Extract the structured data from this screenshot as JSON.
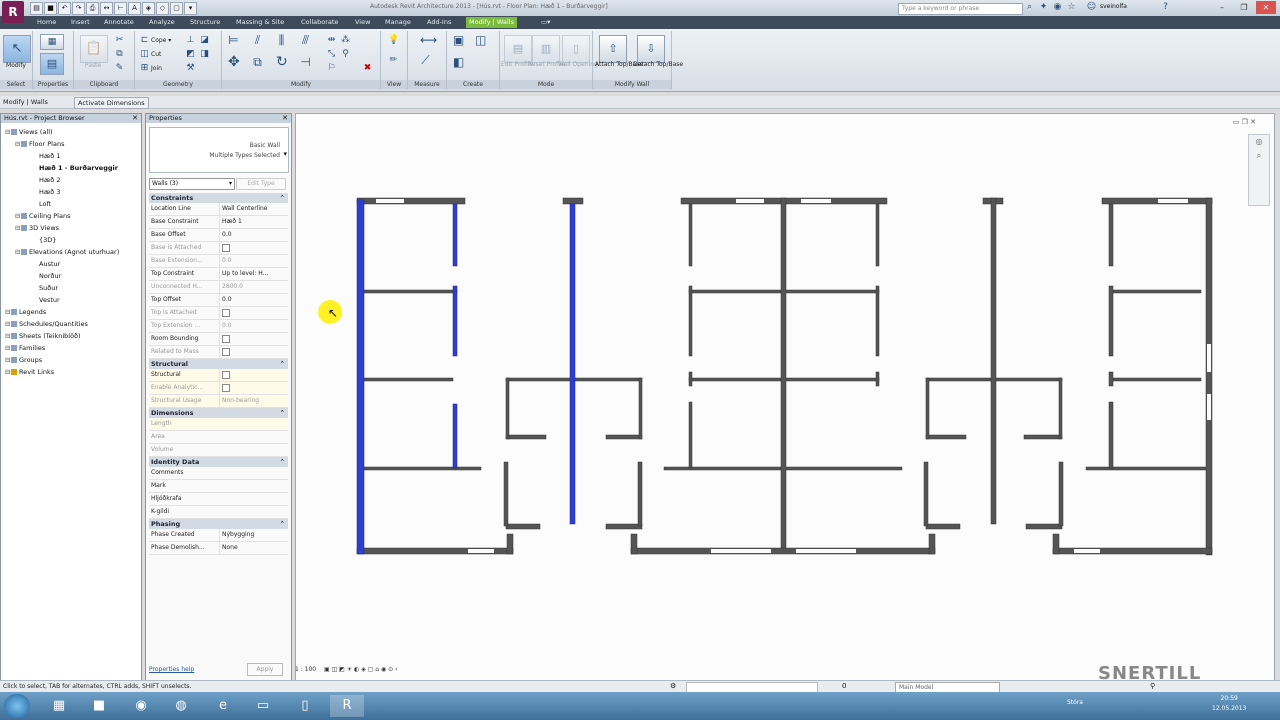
{
  "app": {
    "icon_letter": "R",
    "title": "Autodesk Revit Architecture 2013 - [Hús.rvt - Floor Plan: Hæð 1 - Burðarveggir]",
    "search_placeholder": "Type a keyword or phrase",
    "user": "sveinolfa"
  },
  "tabs": [
    "Home",
    "Insert",
    "Annotate",
    "Analyze",
    "Structure",
    "Massing & Site",
    "Collaborate",
    "View",
    "Manage",
    "Add-Ins",
    "Modify | Walls"
  ],
  "ribbon": {
    "select": {
      "modify_label": "Modify",
      "panel": "Select"
    },
    "properties": {
      "panel": "Properties"
    },
    "clipboard": {
      "paste_label": "Paste",
      "copy_label": "Copy",
      "cut_label": "Cut",
      "join_label": "Join",
      "panel": "Clipboard"
    },
    "geometry": {
      "panel": "Geometry"
    },
    "modify": {
      "panel": "Modify"
    },
    "view": {
      "panel": "View"
    },
    "measure": {
      "panel": "Measure"
    },
    "create": {
      "panel": "Create"
    },
    "mode": {
      "edit_profile": "Edit Profile",
      "reset_profile": "Reset Profile",
      "wall_opening": "Wall Opening",
      "panel": "Mode"
    },
    "modify_wall": {
      "attach": "Attach Top/Base",
      "detach": "Detach Top/Base",
      "panel": "Modify Wall"
    }
  },
  "options_bar": {
    "context": "Modify | Walls",
    "activate_dimensions": "Activate Dimensions"
  },
  "project_browser": {
    "title": "Hús.rvt - Project Browser",
    "items": [
      {
        "label": "Views (all)",
        "level": 0,
        "bold": false
      },
      {
        "label": "Floor Plans",
        "level": 1,
        "bold": false
      },
      {
        "label": "Hæð 1",
        "level": 2,
        "bold": false
      },
      {
        "label": "Hæð 1 - Burðarveggir",
        "level": 2,
        "bold": true
      },
      {
        "label": "Hæð 2",
        "level": 2,
        "bold": false
      },
      {
        "label": "Hæð 3",
        "level": 2,
        "bold": false
      },
      {
        "label": "Loft",
        "level": 2,
        "bold": false
      },
      {
        "label": "Ceiling Plans",
        "level": 1,
        "bold": false
      },
      {
        "label": "3D Views",
        "level": 1,
        "bold": false
      },
      {
        "label": "{3D}",
        "level": 2,
        "bold": false
      },
      {
        "label": "Elevations (Agnot uturhuar)",
        "level": 1,
        "bold": false
      },
      {
        "label": "Austur",
        "level": 2,
        "bold": false
      },
      {
        "label": "Norður",
        "level": 2,
        "bold": false
      },
      {
        "label": "Suður",
        "level": 2,
        "bold": false
      },
      {
        "label": "Vestur",
        "level": 2,
        "bold": false
      },
      {
        "label": "Legends",
        "level": 0,
        "bold": false
      },
      {
        "label": "Schedules/Quantities",
        "level": 0,
        "bold": false
      },
      {
        "label": "Sheets (Teikniblöð)",
        "level": 0,
        "bold": false
      },
      {
        "label": "Families",
        "level": 0,
        "bold": false
      },
      {
        "label": "Groups",
        "level": 0,
        "bold": false
      },
      {
        "label": "Revit Links",
        "level": 0,
        "bold": false
      }
    ]
  },
  "properties": {
    "title": "Properties",
    "type_name": "Basic Wall",
    "type_sub": "Multiple Types Selected",
    "filter": "Walls (3)",
    "edit_type": "Edit Type",
    "groups": [
      {
        "name": "Constraints",
        "rows": [
          {
            "k": "Location Line",
            "v": "Wall Centerline",
            "dim": false,
            "hl": false
          },
          {
            "k": "Base Constraint",
            "v": "Hæð 1",
            "dim": false,
            "hl": false
          },
          {
            "k": "Base Offset",
            "v": "0.0",
            "dim": false,
            "hl": false
          },
          {
            "k": "Base is Attached",
            "v": "",
            "dim": true,
            "hl": false,
            "cb": true
          },
          {
            "k": "Base Extension...",
            "v": "0.0",
            "dim": true,
            "hl": false
          },
          {
            "k": "Top Constraint",
            "v": "Up to level: H...",
            "dim": false,
            "hl": false
          },
          {
            "k": "Unconnected H...",
            "v": "2800.0",
            "dim": true,
            "hl": false
          },
          {
            "k": "Top Offset",
            "v": "0.0",
            "dim": false,
            "hl": false
          },
          {
            "k": "Top is Attached",
            "v": "",
            "dim": true,
            "hl": false,
            "cb": true
          },
          {
            "k": "Top Extension ...",
            "v": "0.0",
            "dim": true,
            "hl": false
          },
          {
            "k": "Room Bounding",
            "v": "",
            "dim": false,
            "hl": false,
            "cb": true
          },
          {
            "k": "Related to Mass",
            "v": "",
            "dim": true,
            "hl": false,
            "cb": true
          }
        ]
      },
      {
        "name": "Structural",
        "rows": [
          {
            "k": "Structural",
            "v": "",
            "dim": false,
            "hl": true,
            "cb": true
          },
          {
            "k": "Enable Analytic...",
            "v": "",
            "dim": true,
            "hl": true,
            "cb": true
          },
          {
            "k": "Structural Usage",
            "v": "Non-bearing",
            "dim": true,
            "hl": true
          }
        ]
      },
      {
        "name": "Dimensions",
        "rows": [
          {
            "k": "Length",
            "v": "",
            "dim": true,
            "hl": true
          },
          {
            "k": "Area",
            "v": "",
            "dim": true,
            "hl": false
          },
          {
            "k": "Volume",
            "v": "",
            "dim": true,
            "hl": false
          }
        ]
      },
      {
        "name": "Identity Data",
        "rows": [
          {
            "k": "Comments",
            "v": "",
            "dim": false,
            "hl": false
          },
          {
            "k": "Mark",
            "v": "",
            "dim": false,
            "hl": false
          },
          {
            "k": "Hljóðkrafa",
            "v": "",
            "dim": false,
            "hl": false
          },
          {
            "k": "K-gildi",
            "v": "",
            "dim": false,
            "hl": false
          }
        ]
      },
      {
        "name": "Phasing",
        "rows": [
          {
            "k": "Phase Created",
            "v": "Nýbygging",
            "dim": false,
            "hl": false
          },
          {
            "k": "Phase Demolish...",
            "v": "None",
            "dim": false,
            "hl": false
          }
        ]
      }
    ],
    "help_link": "Properties help",
    "apply": "Apply"
  },
  "view_control": {
    "scale": "1 : 100"
  },
  "status": {
    "text": "Click to select, TAB for alternates, CTRL adds, SHIFT unselects.",
    "model": "Main Model",
    "zero": "0"
  },
  "taskbar": {
    "lang": "Stóra",
    "time": "20:59",
    "date": "12.05.2013"
  },
  "watermark": "SNERTILL",
  "colors": {
    "accent": "#7cbc3c",
    "selected_wall": "#2e3fd0",
    "wall": "#555555",
    "tabbar": "#3d4b5c"
  }
}
